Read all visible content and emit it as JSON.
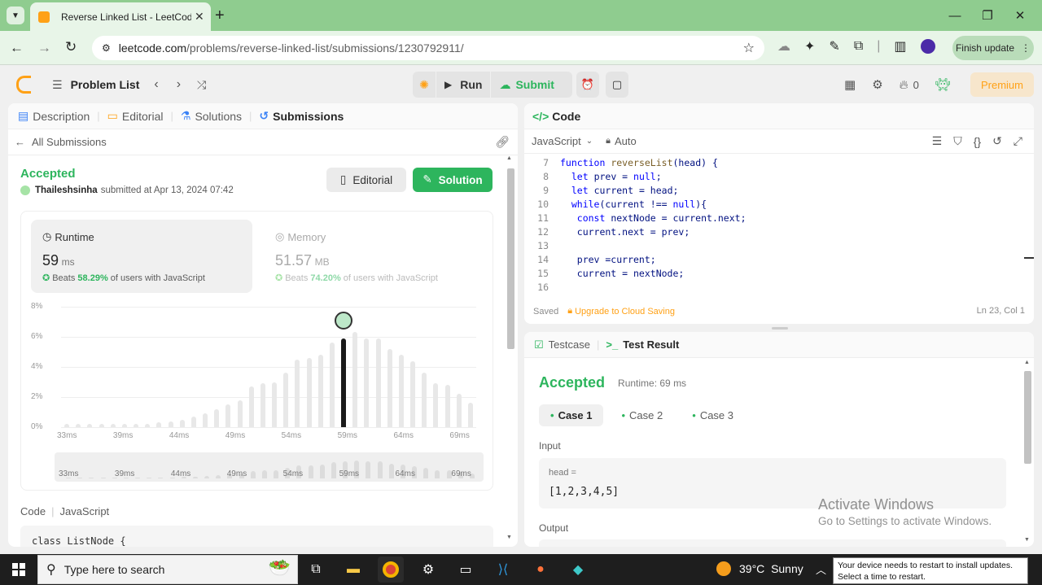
{
  "browser": {
    "tab_title": "Reverse Linked List - LeetCode",
    "url_host": "leetcode.com",
    "url_path": "/problems/reverse-linked-list/submissions/1230792911/",
    "finish_update": "Finish update"
  },
  "topbar": {
    "problem_list": "Problem List",
    "run": "Run",
    "submit": "Submit",
    "streak": "0",
    "premium": "Premium"
  },
  "left": {
    "tabs": [
      "Description",
      "Editorial",
      "Solutions",
      "Submissions"
    ],
    "all_submissions": "All Submissions",
    "status": "Accepted",
    "user": "Thaileshsinha",
    "submitted_at": "submitted at Apr 13, 2024 07:42",
    "editorial_btn": "Editorial",
    "solution_btn": "Solution",
    "runtime": {
      "label": "Runtime",
      "value": "59",
      "unit": "ms",
      "beats_label": "Beats",
      "beats_pct": "58.29%",
      "beats_suffix": "of users with JavaScript"
    },
    "memory": {
      "label": "Memory",
      "value": "51.57",
      "unit": "MB",
      "beats_label": "Beats",
      "beats_pct": "74.20%",
      "beats_suffix": "of users with JavaScript"
    },
    "code_lang_label": "Code",
    "code_lang": "JavaScript",
    "code_preview": "class ListNode {"
  },
  "chart_data": {
    "type": "bar",
    "y_ticks": [
      "8%",
      "6%",
      "4%",
      "2%",
      "0%"
    ],
    "ylim": [
      0,
      8
    ],
    "x_ticks": [
      "33ms",
      "39ms",
      "44ms",
      "49ms",
      "54ms",
      "59ms",
      "64ms",
      "69ms"
    ],
    "values": [
      0.2,
      0.2,
      0.2,
      0.2,
      0.2,
      0.2,
      0.2,
      0.2,
      0.3,
      0.4,
      0.5,
      0.7,
      0.9,
      1.2,
      1.5,
      1.8,
      2.7,
      2.9,
      3.0,
      3.6,
      4.5,
      4.6,
      4.8,
      5.6,
      5.9,
      6.3,
      5.9,
      5.9,
      5.2,
      4.8,
      4.4,
      3.6,
      2.9,
      2.8,
      2.2,
      1.6
    ],
    "highlight_index": 24,
    "highlight_label": "59ms"
  },
  "editor": {
    "title": "Code",
    "language": "JavaScript",
    "mode": "Auto",
    "lines": [
      {
        "n": "7",
        "code": "function reverseList(head) {"
      },
      {
        "n": "8",
        "code": "  let prev = null;"
      },
      {
        "n": "9",
        "code": "  let current = head;"
      },
      {
        "n": "10",
        "code": "  while(current !== null){"
      },
      {
        "n": "11",
        "code": "   const nextNode = current.next;"
      },
      {
        "n": "12",
        "code": "   current.next = prev;"
      },
      {
        "n": "13",
        "code": ""
      },
      {
        "n": "14",
        "code": "   prev =current;"
      },
      {
        "n": "15",
        "code": "   current = nextNode;"
      },
      {
        "n": "16",
        "code": ""
      }
    ],
    "saved": "Saved",
    "upgrade": "Upgrade to Cloud Saving",
    "cursor": "Ln 23, Col 1"
  },
  "result": {
    "tab_testcase": "Testcase",
    "tab_result": "Test Result",
    "status": "Accepted",
    "runtime": "Runtime: 69 ms",
    "cases": [
      "Case 1",
      "Case 2",
      "Case 3"
    ],
    "input_label": "Input",
    "input_var": "head =",
    "input_value": "[1,2,3,4,5]",
    "output_label": "Output"
  },
  "watermark": {
    "line1": "Activate Windows",
    "line2": "Go to Settings to activate Windows."
  },
  "taskbar": {
    "search_placeholder": "Type here to search",
    "temp": "39°C",
    "weather": "Sunny",
    "notice_line1": "Your device needs to restart to install updates.",
    "notice_line2": "Select a time to restart."
  },
  "colors": {
    "accent_green": "#2db55d",
    "premium_orange": "#ffa116",
    "chrome_green": "#8fcc8f"
  }
}
